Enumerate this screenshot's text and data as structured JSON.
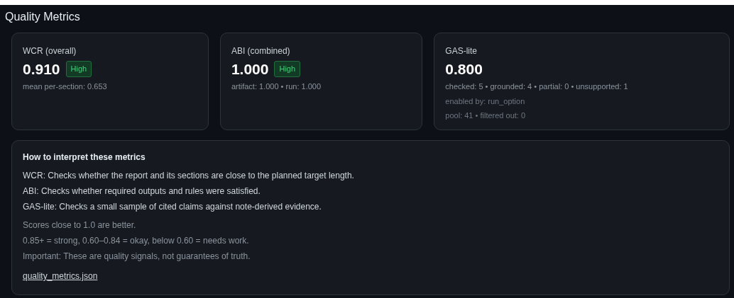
{
  "title": "Quality Metrics",
  "metrics": [
    {
      "label": "WCR (overall)",
      "value": "0.910",
      "badge": {
        "text": "High",
        "kind": "positive"
      },
      "notes": [
        {
          "text": "mean per-section: 0.653",
          "kind": "secondary"
        }
      ]
    },
    {
      "label": "ABI (combined)",
      "value": "1.000",
      "badge": {
        "text": "High",
        "kind": "positive"
      },
      "notes": [
        {
          "text": "artifact: 1.000 • run: 1.000",
          "kind": "secondary"
        }
      ]
    },
    {
      "label": "GAS-lite",
      "value": "0.800",
      "notes": [
        {
          "text": "checked: 5 • grounded: 4 • partial: 0 • unsupported: 1",
          "kind": "secondary"
        },
        {
          "text": "enabled by: run_option",
          "kind": "dim"
        },
        {
          "text": "pool: 41 • filtered out: 0",
          "kind": "dim"
        }
      ]
    }
  ],
  "help": {
    "heading": "How to interpret these metrics",
    "lines": [
      {
        "text": "WCR: Checks whether the report and its sections are close to the planned target length.",
        "kind": "primary"
      },
      {
        "text": "ABI: Checks whether required outputs and rules were satisfied.",
        "kind": "primary"
      },
      {
        "text": "GAS-lite: Checks a small sample of cited claims against note-derived evidence.",
        "kind": "primary"
      },
      {
        "text": "Scores close to 1.0 are better.",
        "kind": "secondary"
      },
      {
        "text": "0.85+ = strong, 0.60–0.84 = okay, below 0.60 = needs work.",
        "kind": "secondary"
      },
      {
        "text": "Important: These are quality signals, not guarantees of truth.",
        "kind": "secondary"
      }
    ],
    "link": "quality_metrics.json"
  }
}
